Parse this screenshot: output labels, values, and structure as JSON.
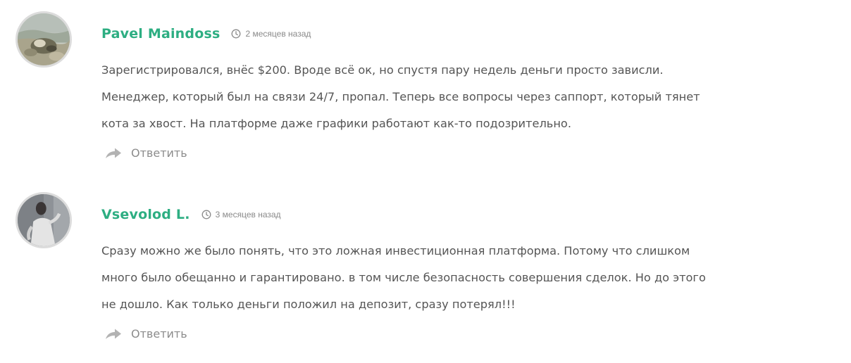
{
  "comments": [
    {
      "author": "Pavel Maindoss",
      "time": "2 месяцев назад",
      "lines": [
        "Зарегистрировался, внёс $200. Вроде всё ок, но спустя пару недель деньги просто зависли.",
        "Менеджер, который был на связи 24/7, пропал. Теперь все вопросы через саппорт, который тянет",
        "кота за хвост. На платформе даже графики работают как-то подозрительно."
      ],
      "reply_label": "Ответить"
    },
    {
      "author": "Vsevolod L.",
      "time": "3 месяцев назад",
      "lines": [
        "Сразу можно же было понять, что это ложная инвестиционная платформа. Потому что слишком",
        "много было обещанно и гарантировано. в том числе безопасность совершения сделок. Но до этого",
        "не дошло. Как только деньги положил на депозит, сразу потерял!!!"
      ],
      "reply_label": "Ответить"
    }
  ],
  "colors": {
    "author": "#2dae82",
    "text": "#555555",
    "muted": "#8c8c8c",
    "avatar_border": "#dcdcdc"
  },
  "icons": {
    "time": "clock-icon",
    "reply": "reply-arrow-icon"
  }
}
